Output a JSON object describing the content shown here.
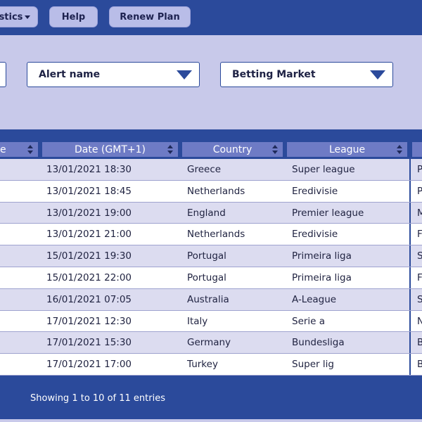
{
  "nav": {
    "statistics_label": "stics",
    "help_label": "Help",
    "renew_label": "Renew Plan"
  },
  "filters": {
    "alert_name": "Alert name",
    "betting_market": "Betting Market"
  },
  "table": {
    "columns": [
      "e",
      "Date (GMT+1)",
      "Country",
      "League",
      ""
    ],
    "rows": [
      {
        "date": "13/01/2021 18:30",
        "country": "Greece",
        "league": "Super league",
        "next": "P"
      },
      {
        "date": "13/01/2021 18:45",
        "country": "Netherlands",
        "league": "Eredivisie",
        "next": "P"
      },
      {
        "date": "13/01/2021 19:00",
        "country": "England",
        "league": "Premier league",
        "next": "M"
      },
      {
        "date": "13/01/2021 21:00",
        "country": "Netherlands",
        "league": "Eredivisie",
        "next": "F"
      },
      {
        "date": "15/01/2021 19:30",
        "country": "Portugal",
        "league": "Primeira liga",
        "next": "S"
      },
      {
        "date": "15/01/2021 22:00",
        "country": "Portugal",
        "league": "Primeira liga",
        "next": "F"
      },
      {
        "date": "16/01/2021 07:05",
        "country": "Australia",
        "league": "A-League",
        "next": "S"
      },
      {
        "date": "17/01/2021 12:30",
        "country": "Italy",
        "league": "Serie a",
        "next": "N"
      },
      {
        "date": "17/01/2021 15:30",
        "country": "Germany",
        "league": "Bundesliga",
        "next": "B"
      },
      {
        "date": "17/01/2021 17:00",
        "country": "Turkey",
        "league": "Super lig",
        "next": "B"
      }
    ]
  },
  "footer": {
    "info": "Showing 1 to 10 of 11 entries"
  },
  "colors": {
    "primary": "#2b4a9b",
    "panel": "#c8c9ea",
    "header_cell": "#6e7bc5",
    "button": "#b9bde8"
  }
}
